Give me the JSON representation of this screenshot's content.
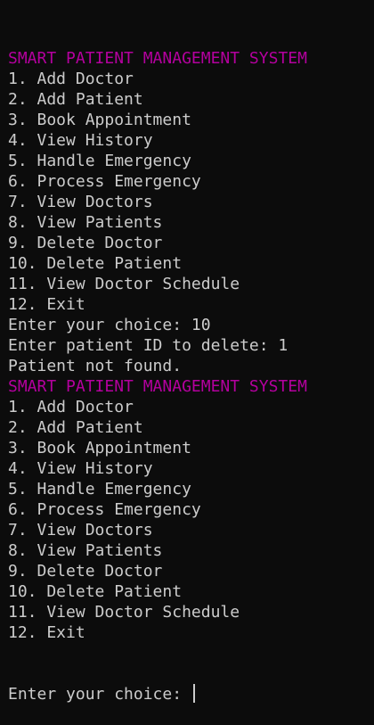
{
  "colors": {
    "background": "#0c0c0c",
    "text": "#cccccc",
    "title": "#b4009e"
  },
  "terminal": {
    "lines": [
      {
        "text": "SMART PATIENT MANAGEMENT SYSTEM",
        "kind": "title"
      },
      {
        "text": "1. Add Doctor",
        "kind": "menu-item"
      },
      {
        "text": "2. Add Patient",
        "kind": "menu-item"
      },
      {
        "text": "3. Book Appointment",
        "kind": "menu-item"
      },
      {
        "text": "4. View History",
        "kind": "menu-item"
      },
      {
        "text": "5. Handle Emergency",
        "kind": "menu-item"
      },
      {
        "text": "6. Process Emergency",
        "kind": "menu-item"
      },
      {
        "text": "7. View Doctors",
        "kind": "menu-item"
      },
      {
        "text": "8. View Patients",
        "kind": "menu-item"
      },
      {
        "text": "9. Delete Doctor",
        "kind": "menu-item"
      },
      {
        "text": "10. Delete Patient",
        "kind": "menu-item"
      },
      {
        "text": "11. View Doctor Schedule",
        "kind": "menu-item"
      },
      {
        "text": "12. Exit",
        "kind": "menu-item"
      },
      {
        "text": "Enter your choice: 10",
        "kind": "prompt"
      },
      {
        "text": "Enter patient ID to delete: 1",
        "kind": "prompt"
      },
      {
        "text": "Patient not found.",
        "kind": "output"
      },
      {
        "text": "SMART PATIENT MANAGEMENT SYSTEM",
        "kind": "title"
      },
      {
        "text": "1. Add Doctor",
        "kind": "menu-item"
      },
      {
        "text": "2. Add Patient",
        "kind": "menu-item"
      },
      {
        "text": "3. Book Appointment",
        "kind": "menu-item"
      },
      {
        "text": "4. View History",
        "kind": "menu-item"
      },
      {
        "text": "5. Handle Emergency",
        "kind": "menu-item"
      },
      {
        "text": "6. Process Emergency",
        "kind": "menu-item"
      },
      {
        "text": "7. View Doctors",
        "kind": "menu-item"
      },
      {
        "text": "8. View Patients",
        "kind": "menu-item"
      },
      {
        "text": "9. Delete Doctor",
        "kind": "menu-item"
      },
      {
        "text": "10. Delete Patient",
        "kind": "menu-item"
      },
      {
        "text": "11. View Doctor Schedule",
        "kind": "menu-item"
      },
      {
        "text": "12. Exit",
        "kind": "menu-item"
      }
    ],
    "active_prompt": "Enter your choice: "
  }
}
